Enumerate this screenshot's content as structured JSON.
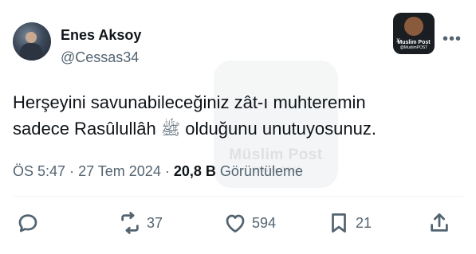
{
  "author": {
    "display_name": "Enes Aksoy",
    "handle": "@Cessas34"
  },
  "badge": {
    "name": "Muslim Post",
    "handle": "@MuslimPOST",
    "x_mark": "X"
  },
  "more_label": "•••",
  "watermark": {
    "name": "Müslim Post",
    "handle": "@MuslimPOST"
  },
  "tweet": {
    "line1": "Herşeyini savunabileceğiniz zât-ı muhteremin",
    "line2_before": "sadece Rasûlullâh",
    "honorific": "ﷺ",
    "line2_after": "olduğunu unutuyosunuz."
  },
  "meta": {
    "time": "ÖS 5:47",
    "date": "27 Tem 2024",
    "separator": "·",
    "views_count": "20,8 B",
    "views_label": "Görüntüleme"
  },
  "actions": {
    "replies": "",
    "retweets": "37",
    "likes": "594",
    "bookmarks": "21"
  },
  "icons": [
    "reply-icon",
    "retweet-icon",
    "like-icon",
    "bookmark-icon",
    "share-icon"
  ]
}
